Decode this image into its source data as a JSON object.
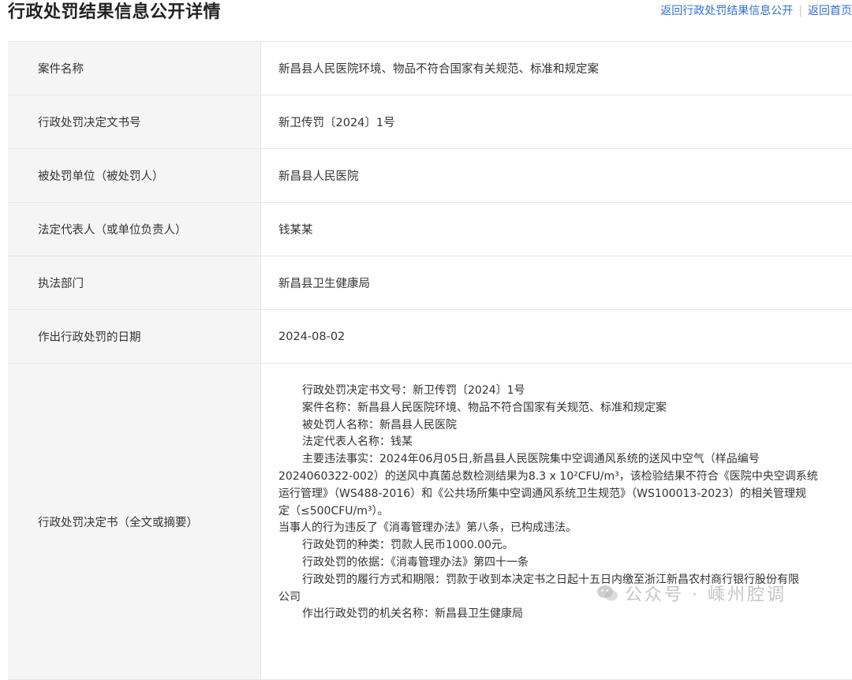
{
  "header": {
    "title": "行政处罚结果信息公开详情",
    "back_list_link": "返回行政处罚结果信息公开",
    "back_home_link": "返回首页"
  },
  "details": {
    "case_name": {
      "label": "案件名称",
      "value": "新昌县人民医院环境、物品不符合国家有关规范、标准和规定案"
    },
    "decision_number": {
      "label": "行政处罚决定文书号",
      "value": "新卫传罚〔2024〕1号"
    },
    "penalized_party": {
      "label": "被处罚单位（被处罚人）",
      "value": "新昌县人民医院"
    },
    "legal_rep": {
      "label": "法定代表人（或单位负责人）",
      "value": "钱某某"
    },
    "department": {
      "label": "执法部门",
      "value": "新昌县卫生健康局"
    },
    "date": {
      "label": "作出行政处罚的日期",
      "value": "2024-08-02"
    },
    "full_text": {
      "label": "行政处罚决定书（全文或摘要）",
      "lines": [
        "行政处罚决定书文号：新卫传罚〔2024〕1号",
        "案件名称：新昌县人民医院环境、物品不符合国家有关规范、标准和规定案",
        "被处罚人名称：新昌县人民医院",
        "法定代表人名称：钱某",
        "主要违法事实：2024年06月05日,新昌县人民医院集中空调通风系统的送风中空气（样品编号",
        "2024060322-002）的送风中真菌总数检测结果为8.3 x 10²CFU/m³，该检验结果不符合《医院中央空调系统",
        "运行管理》（WS488-2016）和《公共场所集中空调通风系统卫生规范》（WS100013-2023）的相关管理规",
        "定（≤500CFU/m³）。",
        "当事人的行为违反了《消毒管理办法》第八条，已构成违法。",
        "行政处罚的种类：罚款人民币1000.00元。",
        "行政处罚的依据：《消毒管理办法》第四十一条",
        "行政处罚的履行方式和期限：罚款于收到本决定书之日起十五日内缴至浙江新昌农村商行银行股份有限",
        "公司",
        "作出行政处罚的机关名称：新昌县卫生健康局"
      ]
    }
  },
  "watermark": {
    "text": "公众号 · 嵊州腔调",
    "icon": "wechat-icon"
  }
}
